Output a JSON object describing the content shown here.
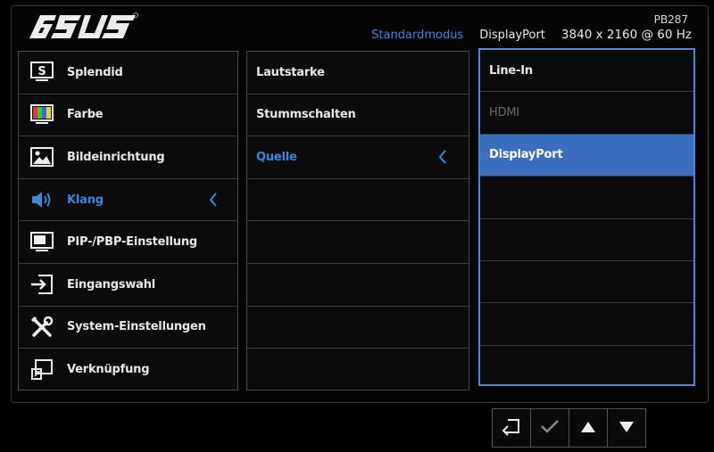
{
  "header": {
    "brand": "ASUS",
    "model": "PB287",
    "mode": "Standardmodus",
    "input": "DisplayPort",
    "resolution": "3840 x 2160 @ 60 Hz"
  },
  "main_menu": {
    "items": [
      {
        "label": "Splendid",
        "icon": "splendid-icon"
      },
      {
        "label": "Farbe",
        "icon": "color-icon"
      },
      {
        "label": "Bildeinrichtung",
        "icon": "image-setup-icon"
      },
      {
        "label": "Klang",
        "icon": "speaker-icon",
        "active": true
      },
      {
        "label": "PIP-/PBP-Einstellung",
        "icon": "pip-icon"
      },
      {
        "label": "Eingangswahl",
        "icon": "input-select-icon"
      },
      {
        "label": "System-Einstellungen",
        "icon": "tools-icon"
      },
      {
        "label": "Verknüpfung",
        "icon": "shortcut-icon"
      }
    ]
  },
  "sub_menu": {
    "items": [
      {
        "label": "Lautstarke"
      },
      {
        "label": "Stummschalten"
      },
      {
        "label": "Quelle",
        "active": true
      },
      {
        "label": ""
      },
      {
        "label": ""
      },
      {
        "label": ""
      },
      {
        "label": ""
      },
      {
        "label": ""
      }
    ]
  },
  "options": {
    "items": [
      {
        "label": "Line-In"
      },
      {
        "label": "HDMI",
        "disabled": true
      },
      {
        "label": "DisplayPort",
        "selected": true
      },
      {
        "label": ""
      },
      {
        "label": ""
      },
      {
        "label": ""
      },
      {
        "label": ""
      },
      {
        "label": ""
      }
    ]
  },
  "colors": {
    "accent": "#3b86e0",
    "selected_bg": "#3a6fc0",
    "option_border": "#4f84d6"
  },
  "nav_buttons": [
    {
      "icon": "back-icon"
    },
    {
      "icon": "check-icon"
    },
    {
      "icon": "up-arrow-icon"
    },
    {
      "icon": "down-arrow-icon"
    }
  ]
}
